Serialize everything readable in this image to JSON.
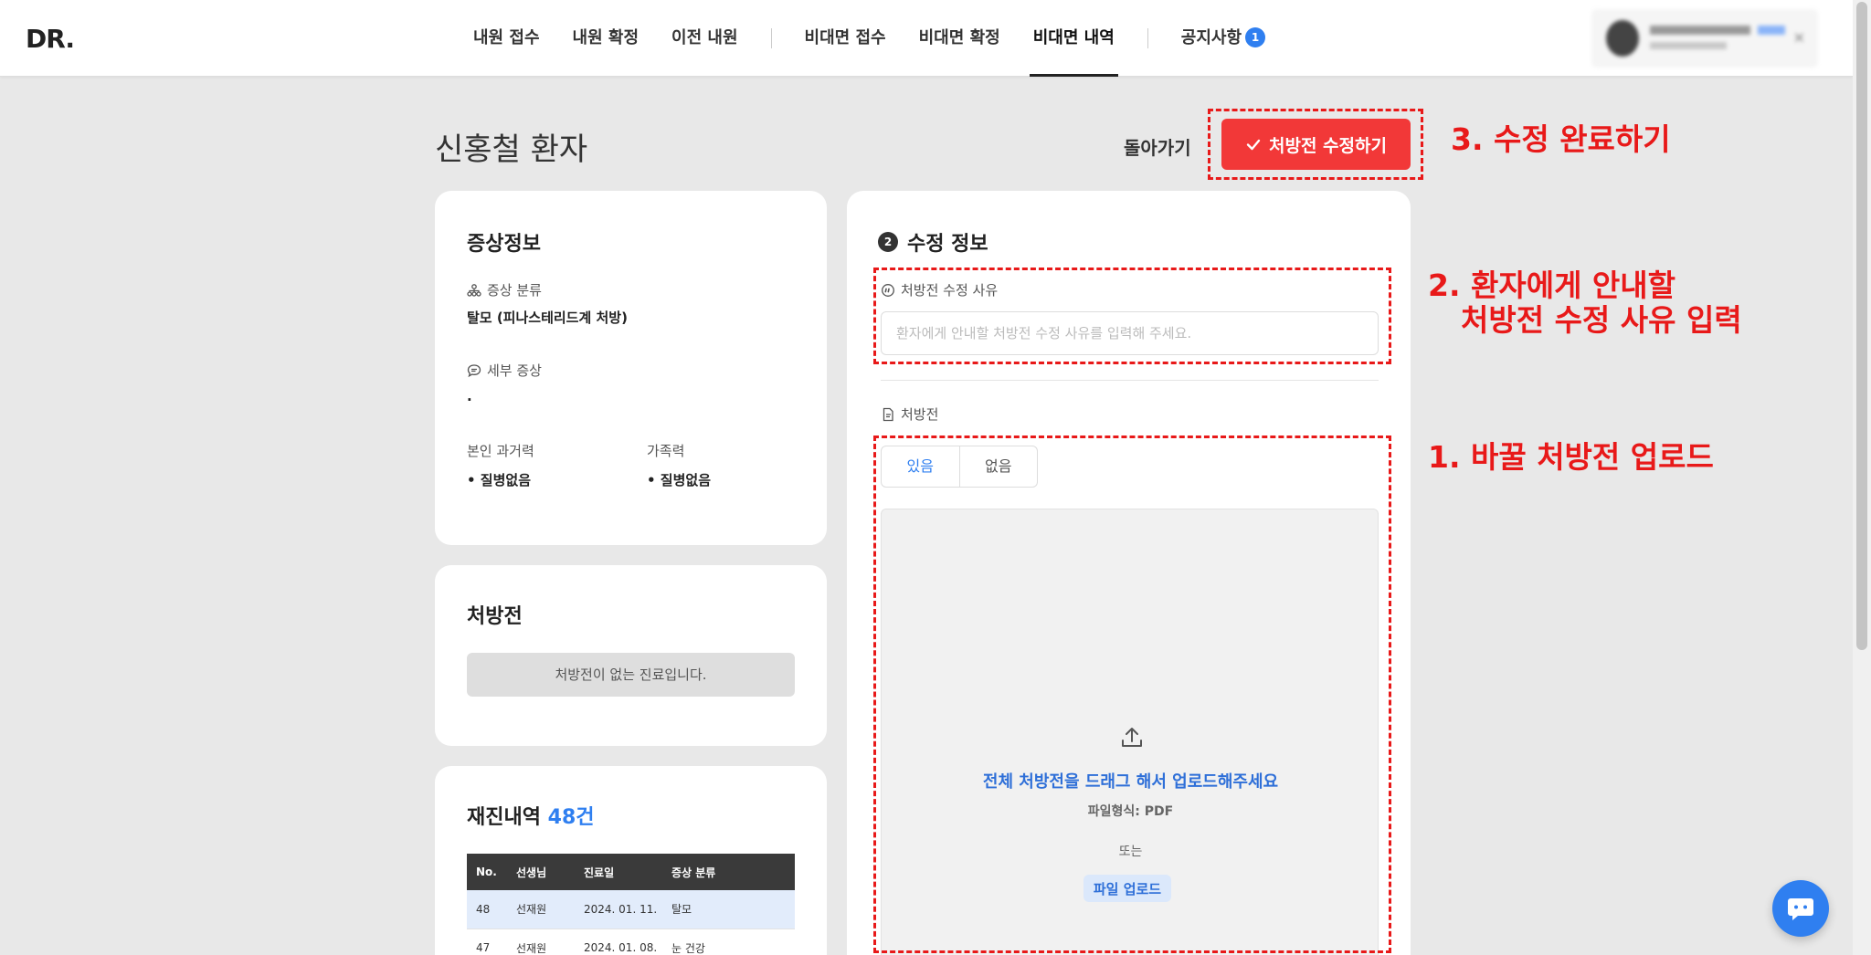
{
  "header": {
    "logo": "DR.",
    "nav": [
      {
        "label": "내원 접수"
      },
      {
        "label": "내원 확정"
      },
      {
        "label": "이전 내원"
      },
      {
        "label": "비대면 접수"
      },
      {
        "label": "비대면 확정"
      },
      {
        "label": "비대면 내역",
        "active": true
      },
      {
        "label": "공지사항",
        "badge": "1"
      }
    ]
  },
  "page": {
    "title": "신홍철 환자",
    "back_label": "돌아가기",
    "save_label": "처방전 수정하기"
  },
  "symptom": {
    "heading": "증상정보",
    "category_label": "증상 분류",
    "category_value": "탈모 (피나스테리드계 처방)",
    "detail_label": "세부 증상",
    "detail_value": ".",
    "personal_history_label": "본인 과거력",
    "personal_history_value": "• 질병없음",
    "family_history_label": "가족력",
    "family_history_value": "• 질병없음"
  },
  "prescription": {
    "heading": "처방전",
    "empty_text": "처방전이 없는 진료입니다."
  },
  "history": {
    "heading": "재진내역",
    "count": "48건",
    "columns": [
      "No.",
      "선생님",
      "진료일",
      "증상 분류"
    ],
    "rows": [
      [
        "48",
        "선재원",
        "2024. 01. 11.",
        "탈모"
      ],
      [
        "47",
        "선재원",
        "2024. 01. 08.",
        "눈 건강"
      ]
    ]
  },
  "edit": {
    "step_number": "2",
    "heading": "수정 정보",
    "reason_label": "처방전 수정 사유",
    "reason_placeholder": "환자에게 안내할 처방전 수정 사유를 입력해 주세요.",
    "rx_label": "처방전",
    "toggle": [
      "있음",
      "없음"
    ],
    "upload_main": "전체 처방전을 드래그 해서 업로드해주세요",
    "upload_format": "파일형식: PDF",
    "upload_or": "또는",
    "upload_button": "파일 업로드"
  },
  "annotations": {
    "step3": "3. 수정 완료하기",
    "step2_line1": "2. 환자에게 안내할",
    "step2_line2": "처방전 수정 사유 입력",
    "step1": "1. 바꿀 처방전 업로드"
  },
  "colors": {
    "accent_blue": "#2f7ff0",
    "save_red": "#f23838",
    "annotation_red": "#e81919"
  }
}
